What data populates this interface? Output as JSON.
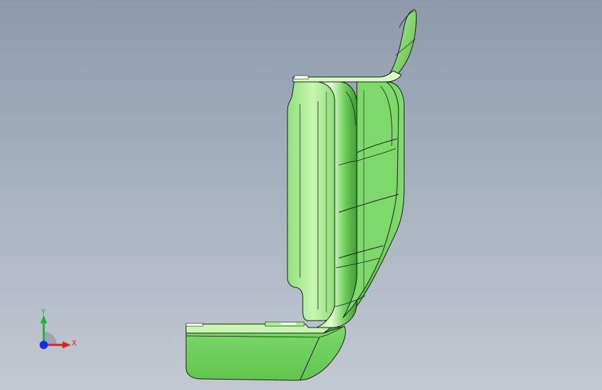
{
  "viewport": {
    "background_top": "#8d9aab",
    "background_bottom": "#c2c9d1"
  },
  "model": {
    "color_main": "#66cc66",
    "color_light": "#c8f7b0",
    "color_dark": "#3b8f2f",
    "edge_color": "#1a1a1a"
  },
  "triad": {
    "x_label": "X",
    "y_label": "Y",
    "x_color": "#e02020",
    "y_color": "#20b040",
    "z_color": "#1030e0"
  }
}
